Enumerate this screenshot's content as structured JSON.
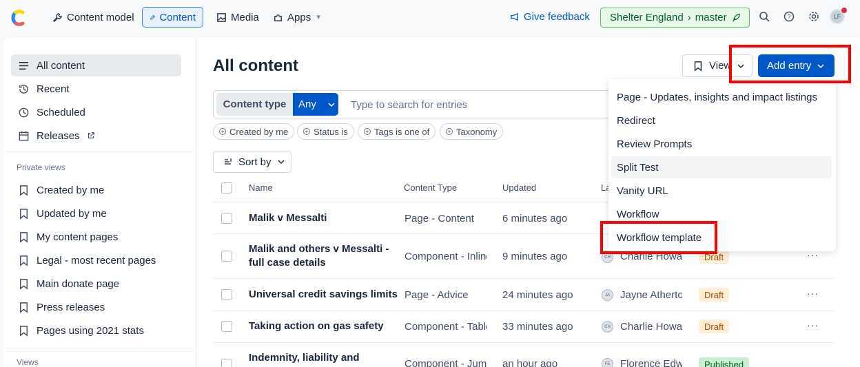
{
  "topnav": {
    "content_model": "Content model",
    "content": "Content",
    "media": "Media",
    "apps": "Apps",
    "feedback": "Give feedback",
    "space": "Shelter England",
    "environment": "master",
    "avatar": "LF"
  },
  "sidebar": {
    "items": [
      {
        "label": "All content",
        "icon": "list-icon"
      },
      {
        "label": "Recent",
        "icon": "history-icon"
      },
      {
        "label": "Scheduled",
        "icon": "clock-icon"
      },
      {
        "label": "Releases",
        "icon": "calendar-icon"
      }
    ],
    "private_views_heading": "Private views",
    "private_views": [
      "Created by me",
      "Updated by me",
      "My content pages",
      "Legal - most recent pages",
      "Main donate page",
      "Press releases",
      "Pages using 2021 stats"
    ],
    "views_heading": "Views"
  },
  "main": {
    "title": "All content",
    "view_label": "View",
    "add_entry": "Add entry",
    "content_type_label": "Content type",
    "content_type_value": "Any",
    "search_placeholder": "Type to search for entries",
    "filters": [
      "Created by me",
      "Status is",
      "Tags is one of",
      "Taxonomy"
    ],
    "sort_label": "Sort by",
    "columns": [
      "Name",
      "Content Type",
      "Updated",
      "La"
    ],
    "rows": [
      {
        "name": "Malik v Messalti",
        "type": "Page - Content",
        "updated": "6 minutes ago",
        "author": "",
        "initials": "",
        "status": ""
      },
      {
        "name": "Malik and others v Messalti - full case details",
        "type": "Component - Inline",
        "updated": "9 minutes ago",
        "author": "Charlie Howar",
        "initials": "CH",
        "status": "Draft"
      },
      {
        "name": "Universal credit savings limits",
        "type": "Page - Advice",
        "updated": "24 minutes ago",
        "author": "Jayne Atherto",
        "initials": "JA",
        "status": "Draft"
      },
      {
        "name": "Taking action on gas safety",
        "type": "Component - Table",
        "updated": "33 minutes ago",
        "author": "Charlie Howar",
        "initials": "CH",
        "status": "Draft"
      },
      {
        "name": "Indemnity, liability and",
        "type": "Component - Jump",
        "updated": "an hour ago",
        "author": "Florence Edwa",
        "initials": "FE",
        "status": "Published"
      }
    ]
  },
  "dropdown": {
    "items": [
      "Page - Updates, insights and impact listings",
      "Redirect",
      "Review Prompts",
      "Split Test",
      "Vanity URL",
      "Workflow",
      "Workflow template"
    ]
  },
  "colors": {
    "primary": "#0059c8",
    "highlight": "#ff0000",
    "env_green": "#00652a"
  }
}
